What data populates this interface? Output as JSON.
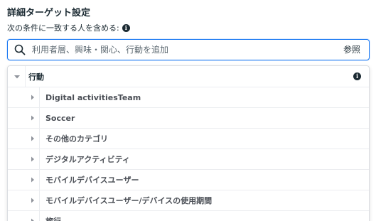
{
  "header": {
    "title": "詳細ターゲット設定",
    "subtitle": "次の条件に一致する人を含める:"
  },
  "search": {
    "placeholder": "利用者層、興味・関心、行動を追加",
    "browse_label": "参照"
  },
  "panel": {
    "category_label": "行動",
    "items": [
      {
        "label": "Digital activitiesTeam"
      },
      {
        "label": "Soccer"
      },
      {
        "label": "その他のカテゴリ"
      },
      {
        "label": "デジタルアクティビティ"
      },
      {
        "label": "モバイルデバイスユーザー"
      },
      {
        "label": "モバイルデバイスユーザー/デバイスの使用期間"
      },
      {
        "label": "旅行"
      }
    ]
  },
  "colors": {
    "accent": "#1877f2",
    "text_dark": "#1c2b33",
    "text_item": "#4b4f56",
    "divider": "#ebedf0"
  },
  "icons": {
    "info": "info-icon",
    "search": "search-icon",
    "collapse": "triangle-down-icon",
    "expand": "triangle-right-icon"
  }
}
